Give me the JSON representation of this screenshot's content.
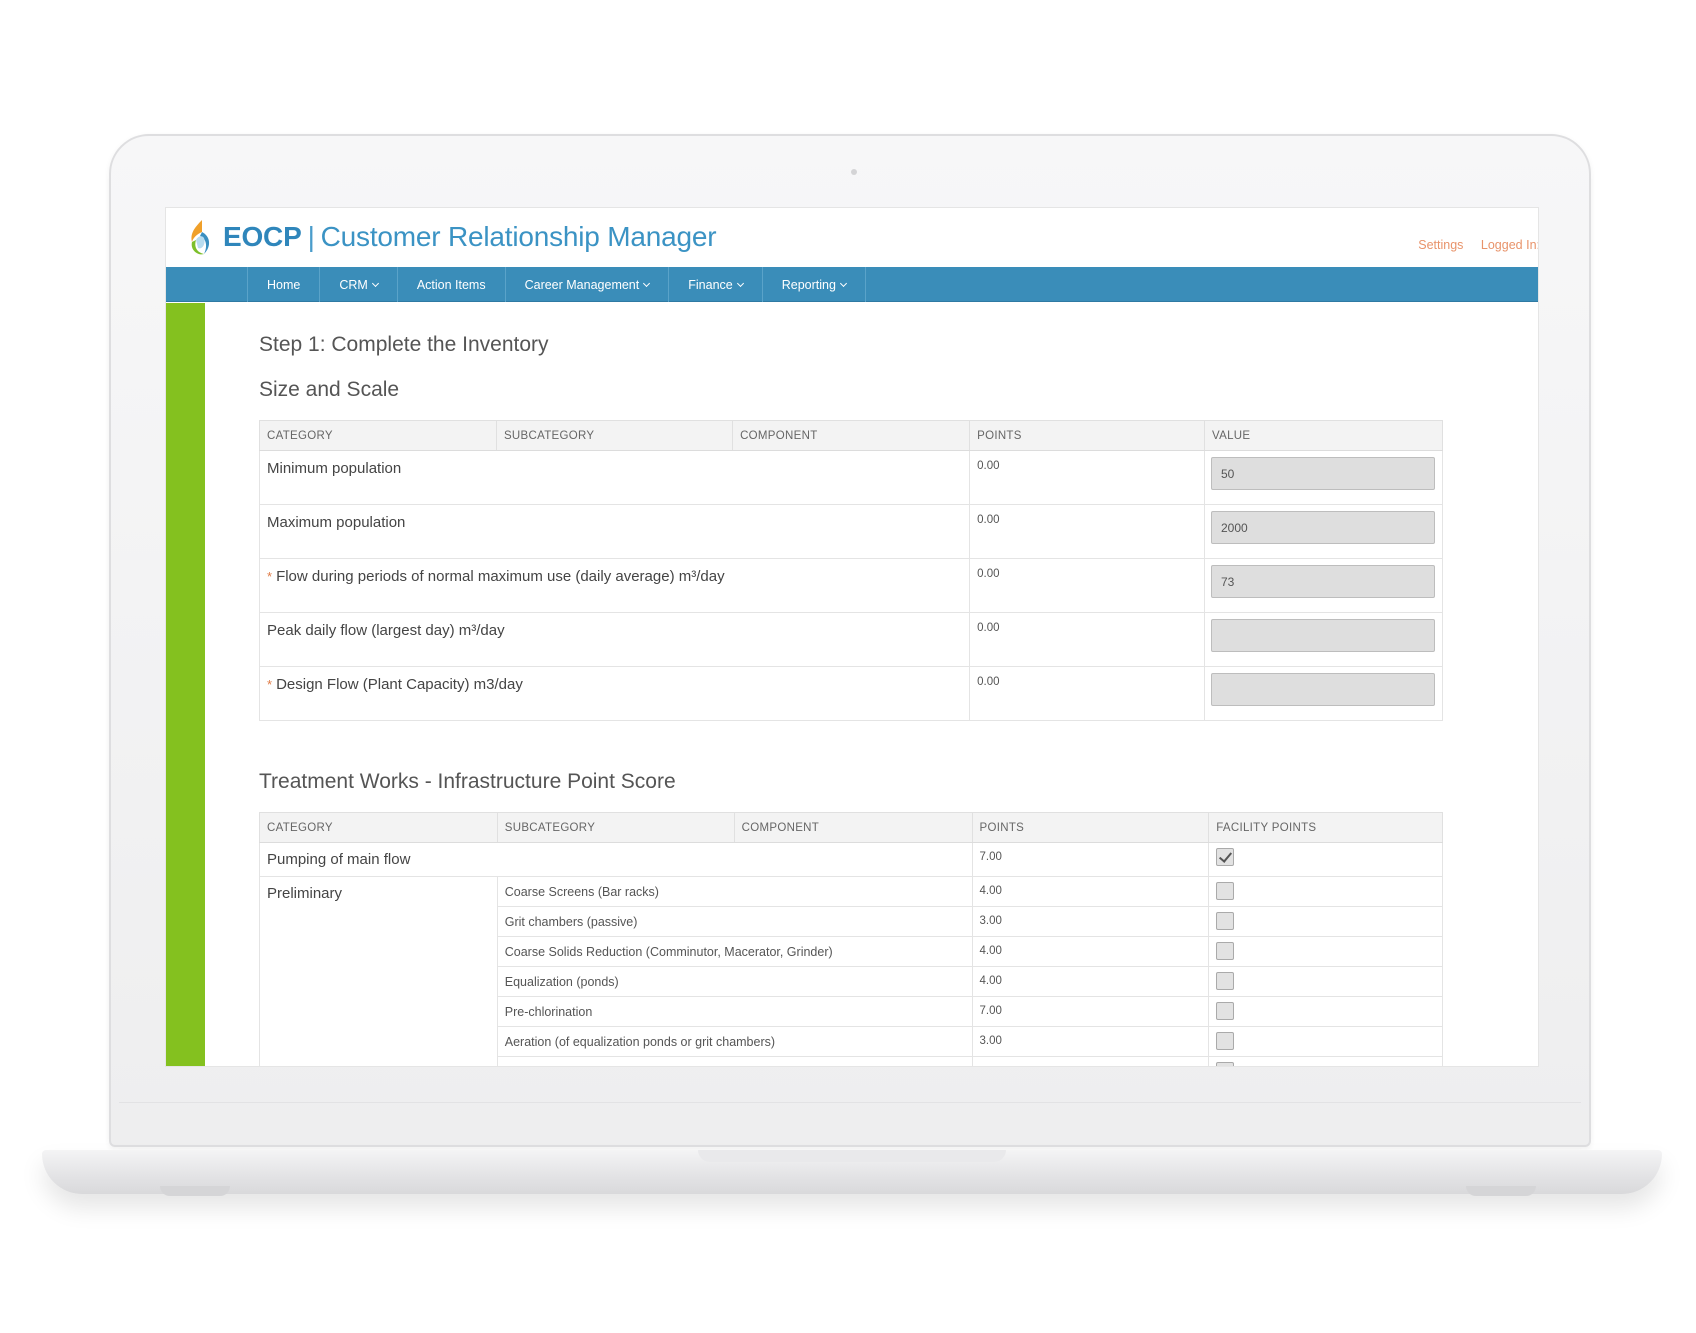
{
  "app": {
    "brand_short": "EOCP",
    "brand_name": "Customer Relationship Manager",
    "header_links": {
      "settings": "Settings",
      "logged_in": "Logged In:"
    },
    "colors": {
      "nav": "#3a8db9",
      "accent_green": "#84c11f",
      "link": "#e8936a"
    }
  },
  "nav": {
    "items": [
      {
        "label": "Home",
        "dropdown": false
      },
      {
        "label": "CRM",
        "dropdown": true
      },
      {
        "label": "Action Items",
        "dropdown": false
      },
      {
        "label": "Career Management",
        "dropdown": true
      },
      {
        "label": "Finance",
        "dropdown": true
      },
      {
        "label": "Reporting",
        "dropdown": true
      }
    ]
  },
  "page": {
    "step_title": "Step 1: Complete the Inventory",
    "size_scale": {
      "title": "Size and Scale",
      "headers": [
        "CATEGORY",
        "SUBCATEGORY",
        "COMPONENT",
        "POINTS",
        "VALUE"
      ],
      "rows": [
        {
          "label": "Minimum population",
          "required": false,
          "points": "0.00",
          "value": "50"
        },
        {
          "label": "Maximum population",
          "required": false,
          "points": "0.00",
          "value": "2000"
        },
        {
          "label": "Flow during periods of normal maximum use (daily average) m³/day",
          "required": true,
          "points": "0.00",
          "value": "73"
        },
        {
          "label": "Peak daily flow (largest day) m³/day",
          "required": false,
          "points": "0.00",
          "value": ""
        },
        {
          "label": "Design Flow (Plant Capacity) m3/day",
          "required": true,
          "points": "0.00",
          "value": ""
        }
      ]
    },
    "treatment": {
      "title": "Treatment Works - Infrastructure Point Score",
      "headers": [
        "CATEGORY",
        "SUBCATEGORY",
        "COMPONENT",
        "POINTS",
        "FACILITY POINTS"
      ],
      "pumping": {
        "label": "Pumping of main flow",
        "points": "7.00",
        "checked": true
      },
      "preliminary": {
        "label": "Preliminary",
        "items": [
          {
            "label": "Coarse Screens (Bar racks)",
            "points": "4.00",
            "checked": false
          },
          {
            "label": "Grit chambers (passive)",
            "points": "3.00",
            "checked": false
          },
          {
            "label": "Coarse Solids Reduction (Comminutor, Macerator, Grinder)",
            "points": "4.00",
            "checked": false
          },
          {
            "label": "Equalization (ponds)",
            "points": "4.00",
            "checked": false
          },
          {
            "label": "Pre-chlorination",
            "points": "7.00",
            "checked": false
          },
          {
            "label": "Aeration (of equalization ponds or grit chambers)",
            "points": "3.00",
            "checked": false
          }
        ]
      }
    }
  }
}
